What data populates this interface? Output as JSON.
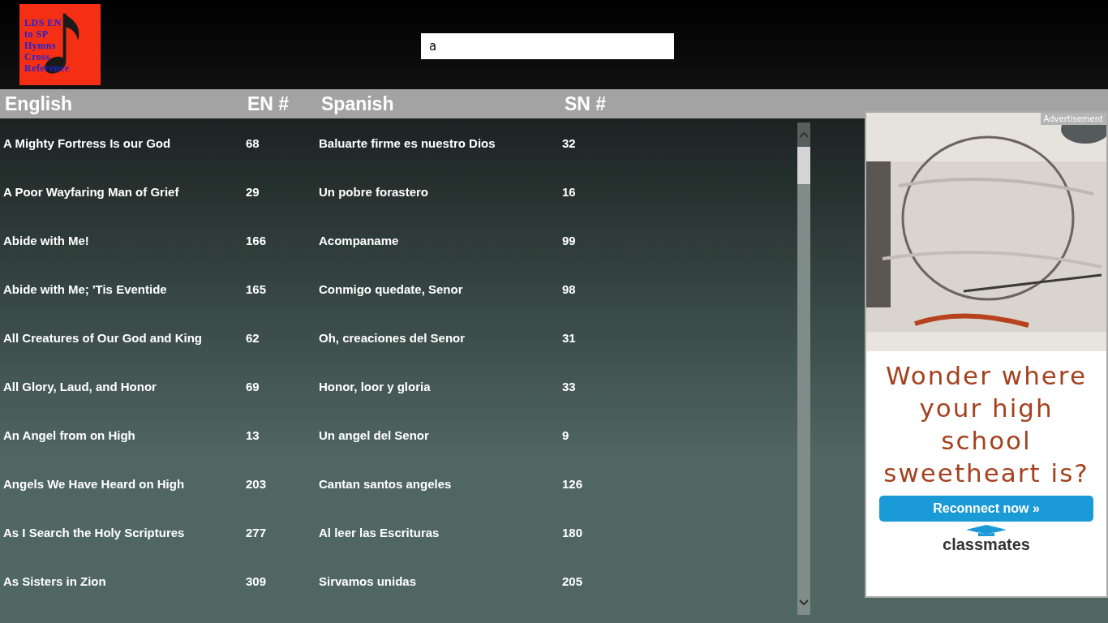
{
  "logo": {
    "lines": [
      "LDS EN",
      "to SP",
      "Hymns",
      "Cross",
      "Reference"
    ]
  },
  "search": {
    "value": "a"
  },
  "table": {
    "columns": [
      "English",
      "EN #",
      "Spanish",
      "SN #"
    ],
    "rows": [
      {
        "english": "A Mighty Fortress Is our God",
        "en": "68",
        "spanish": "Baluarte firme es nuestro Dios",
        "sn": "32"
      },
      {
        "english": "A Poor Wayfaring Man of Grief",
        "en": "29",
        "spanish": "Un pobre forastero",
        "sn": "16"
      },
      {
        "english": "Abide with Me!",
        "en": "166",
        "spanish": "Acompaname",
        "sn": "99"
      },
      {
        "english": "Abide with Me; 'Tis Eventide",
        "en": "165",
        "spanish": "Conmigo quedate, Senor",
        "sn": "98"
      },
      {
        "english": "All Creatures of Our God and King",
        "en": "62",
        "spanish": "Oh, creaciones del Senor",
        "sn": "31"
      },
      {
        "english": "All Glory, Laud, and Honor",
        "en": "69",
        "spanish": "Honor, loor y gloria",
        "sn": "33"
      },
      {
        "english": "An Angel from on High",
        "en": "13",
        "spanish": "Un angel del Senor",
        "sn": "9"
      },
      {
        "english": "Angels We Have Heard on High",
        "en": "203",
        "spanish": "Cantan santos angeles",
        "sn": "126"
      },
      {
        "english": "As I Search the Holy Scriptures",
        "en": "277",
        "spanish": "Al leer las Escrituras",
        "sn": "180"
      },
      {
        "english": "As Sisters in Zion",
        "en": "309",
        "spanish": "Sirvamos unidas",
        "sn": "205"
      }
    ]
  },
  "ad": {
    "label": "Advertisement",
    "headline": "Wonder where your high school sweetheart is?",
    "button": "Reconnect now »",
    "brand": "classmates"
  }
}
